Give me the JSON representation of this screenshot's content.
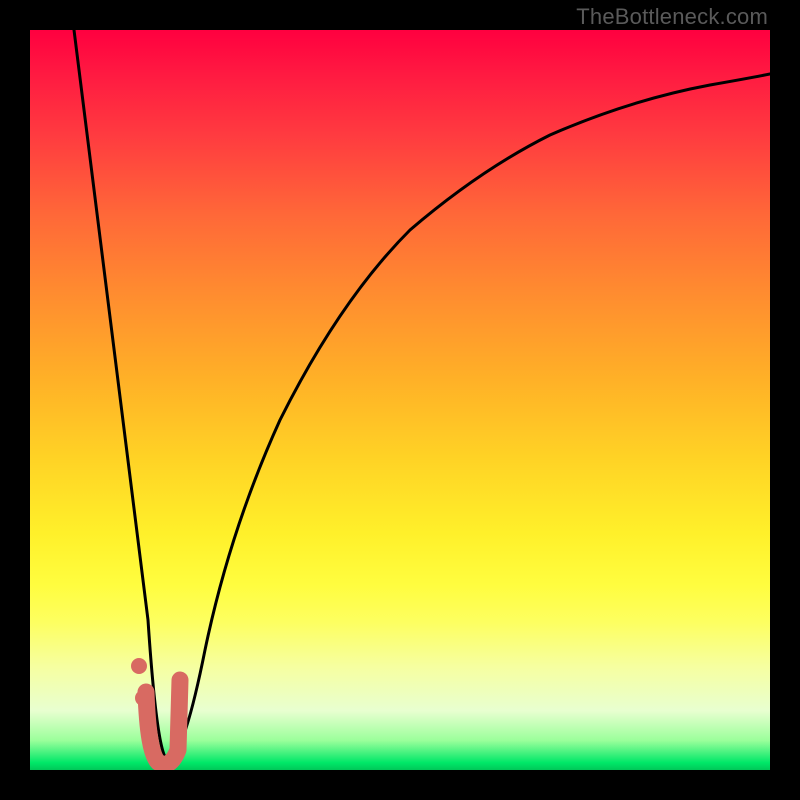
{
  "watermark": "TheBottleneck.com",
  "colors": {
    "background": "#000000",
    "gradient_top": "#ff0040",
    "gradient_mid": "#ffd325",
    "gradient_bottom": "#00c858",
    "curve": "#000000",
    "marker": "#d86a62"
  },
  "chart_data": {
    "type": "line",
    "title": "",
    "xlabel": "",
    "ylabel": "",
    "xlim": [
      0,
      100
    ],
    "ylim": [
      0,
      100
    ],
    "grid": false,
    "legend": false,
    "note": "Y-axis inverted visually: 0 at bottom (green/good), 100 at top (red/bad). Values are estimated from pixel positions; no tick labels are present in the image.",
    "series": [
      {
        "name": "bottleneck-curve",
        "x": [
          6,
          8,
          10,
          12,
          14,
          15,
          16,
          16.8,
          17.5,
          18.5,
          20,
          22,
          25,
          30,
          35,
          40,
          45,
          50,
          55,
          60,
          70,
          80,
          90,
          100
        ],
        "y": [
          100,
          86,
          72,
          58,
          42,
          30,
          18,
          8,
          2,
          2,
          10,
          22,
          38,
          55,
          66,
          73,
          78,
          82,
          85,
          87,
          90,
          92,
          93.5,
          94.5
        ]
      }
    ],
    "markers": [
      {
        "name": "dot-upper",
        "x": 14.7,
        "y": 14
      },
      {
        "name": "dot-lower",
        "x": 15.3,
        "y": 9
      }
    ],
    "highlight_segment": {
      "name": "j-stroke",
      "points_xy": [
        [
          15.7,
          10.5
        ],
        [
          16.2,
          4.5
        ],
        [
          16.8,
          1.8
        ],
        [
          17.8,
          1.0
        ],
        [
          18.8,
          1.2
        ],
        [
          19.6,
          3.0
        ],
        [
          19.9,
          8.0
        ],
        [
          20.0,
          12.0
        ]
      ]
    }
  }
}
